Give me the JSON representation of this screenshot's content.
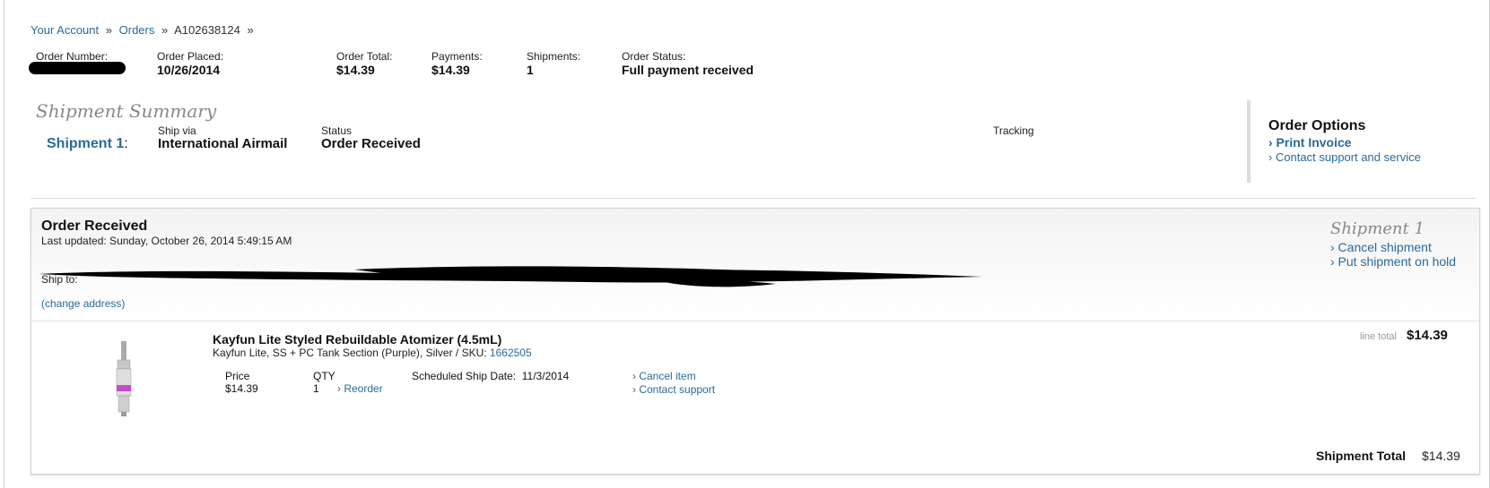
{
  "breadcrumb": {
    "account": "Your Account",
    "sep1": "»",
    "orders": "Orders",
    "sep2": "»",
    "order_id": "A102638124",
    "sep3": "»"
  },
  "order_header": {
    "number_label": "Order Number:",
    "placed_label": "Order Placed:",
    "placed_value": "10/26/2014",
    "total_label": "Order Total:",
    "total_value": "$14.39",
    "payments_label": "Payments:",
    "payments_value": "$14.39",
    "shipments_label": "Shipments:",
    "shipments_value": "1",
    "status_label": "Order Status:",
    "status_value": "Full payment received"
  },
  "summary": {
    "title": "Shipment Summary",
    "shipment_link": "Shipment 1",
    "colon": ":",
    "ship_via_label": "Ship via",
    "ship_via_value": "International Airmail",
    "status_label": "Status",
    "status_value": "Order Received",
    "tracking_label": "Tracking"
  },
  "order_options": {
    "title": "Order Options",
    "print_invoice": "› Print Invoice",
    "contact": "› Contact support and service"
  },
  "shipment": {
    "status_title": "Order Received",
    "last_updated": "Last updated: Sunday, October 26, 2014 5:49:15 AM",
    "ship_to_label": "Ship to:",
    "change_address": "(change address)",
    "title": "Shipment 1",
    "cancel_shipment": "› Cancel shipment",
    "hold_shipment": "› Put shipment on hold",
    "item": {
      "name": "Kayfun Lite Styled Rebuildable Atomizer (4.5mL)",
      "desc": "Kayfun Lite, SS + PC Tank Section (Purple), Silver / SKU: ",
      "sku": "1662505",
      "price_label": "Price",
      "price_value": "$14.39",
      "qty_label": "QTY",
      "qty_value": "1",
      "reorder": "› Reorder",
      "sched_label": "Scheduled Ship Date:",
      "sched_value": "11/3/2014",
      "cancel_item": "› Cancel item",
      "contact_support": "› Contact support",
      "line_total_label": "line total",
      "line_total_value": "$14.39"
    },
    "total_label": "Shipment Total",
    "total_value": "$14.39"
  },
  "colors": {
    "link": "#2a6a99",
    "muted_title": "#888888",
    "redaction": "#000000"
  }
}
